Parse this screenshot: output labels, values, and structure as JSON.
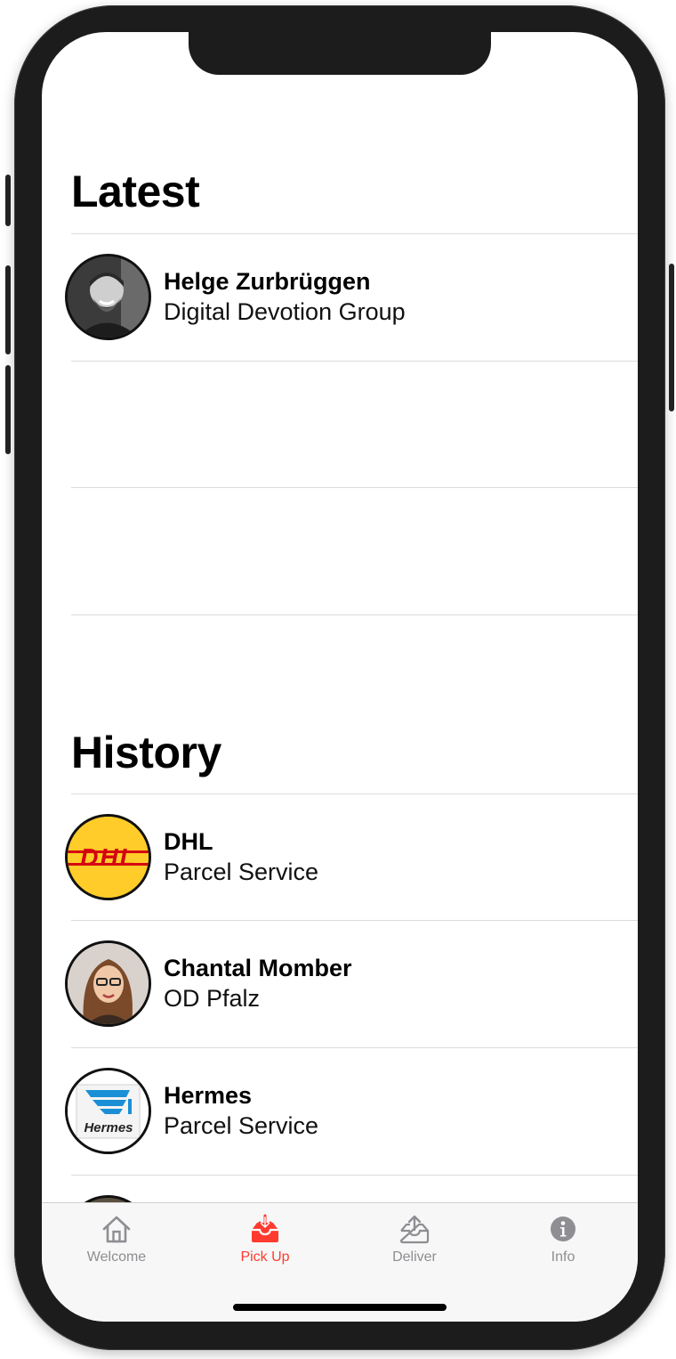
{
  "sections": {
    "latest_title": "Latest",
    "history_title": "History"
  },
  "latest": [
    {
      "title": "Helge Zurbrüggen",
      "subtitle": "Digital Devotion Group",
      "avatar": "person-photo"
    }
  ],
  "history": [
    {
      "title": "DHL",
      "subtitle": "Parcel Service",
      "avatar": "dhl-logo"
    },
    {
      "title": "Chantal Momber",
      "subtitle": "OD Pfalz",
      "avatar": "person-photo"
    },
    {
      "title": "Hermes",
      "subtitle": "Parcel Service",
      "avatar": "hermes-logo"
    }
  ],
  "logos": {
    "dhl_text": "DHL",
    "hermes_text": "Hermes"
  },
  "tabs": [
    {
      "label": "Welcome",
      "icon": "house-icon",
      "active": false
    },
    {
      "label": "Pick Up",
      "icon": "inbox-download-icon",
      "active": true
    },
    {
      "label": "Deliver",
      "icon": "inbox-upload-icon",
      "active": false
    },
    {
      "label": "Info",
      "icon": "info-icon",
      "active": false
    }
  ],
  "colors": {
    "accent": "#ff3b30",
    "inactive_tab": "#8e8e93",
    "dhl_yellow": "#ffcc29",
    "dhl_red": "#d40511",
    "hermes_blue": "#1a8fd6"
  }
}
